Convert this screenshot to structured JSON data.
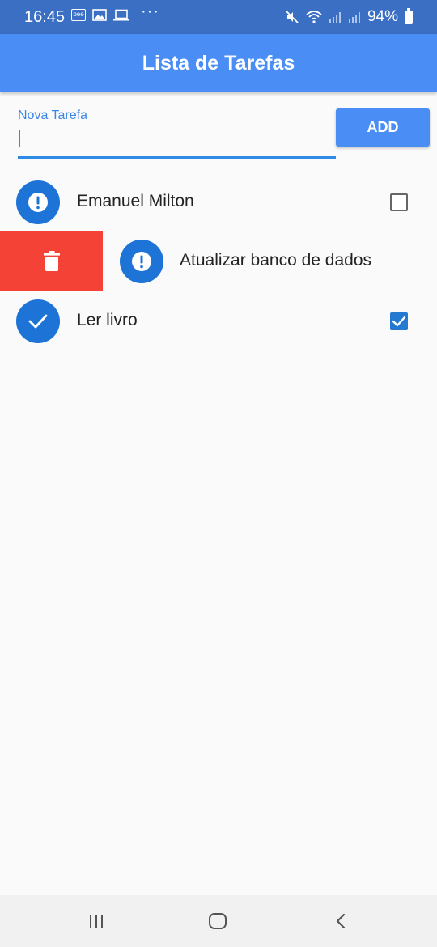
{
  "status_bar": {
    "time": "16:45",
    "notification_icons": [
      "bee-app-icon",
      "image-icon",
      "laptop-icon"
    ],
    "more": "···",
    "battery": "94%"
  },
  "app_bar": {
    "title": "Lista de Tarefas"
  },
  "new_task": {
    "label": "Nova Tarefa",
    "value": "",
    "add_label": "ADD"
  },
  "tasks": [
    {
      "title": "Emanuel Milton",
      "done": false,
      "icon": "exclamation-icon"
    },
    {
      "title": "Atualizar banco de dados",
      "done": false,
      "icon": "exclamation-icon",
      "swiping": true
    },
    {
      "title": "Ler livro",
      "done": true,
      "icon": "check-icon"
    }
  ],
  "colors": {
    "status_bar": "#3a6fc4",
    "app_bar": "#4a8ef5",
    "accent": "#2e8be6",
    "avatar": "#1e73d6",
    "delete": "#f44336"
  },
  "nav": [
    "recent-apps-icon",
    "home-icon",
    "back-icon"
  ]
}
